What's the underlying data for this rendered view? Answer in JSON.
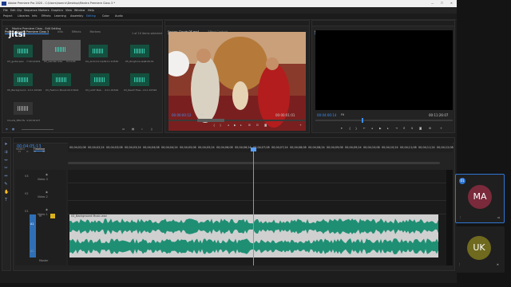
{
  "app": {
    "title": "Adobe Premiere Pro 2020 - C:\\Users\\hamric\\Desktop\\Mantra Premiere Class 3 *",
    "menu": [
      "File",
      "Edit",
      "Clip",
      "Sequence",
      "Markers",
      "Graphics",
      "View",
      "Window",
      "Help"
    ],
    "workspaces": [
      "Project",
      "Libraries",
      "Info",
      "Effects",
      "Learning",
      "Assembly",
      "Editing",
      "Color",
      "Audio"
    ],
    "window_controls": [
      "—",
      "☐",
      "✕"
    ]
  },
  "project_panel": {
    "tabs": [
      "Project: Mantra Premiere Class 3",
      "Info",
      "Effects",
      "Markers"
    ],
    "breadcrumb": "Mantra Premiere Class - Edit Setting",
    "item_count": "1 of 10 items selected",
    "logo": "jitsi",
    "clips": [
      {
        "name": "03_guitar.wav",
        "dur": "7:30:12224"
      },
      {
        "name": "03_Garden.wav",
        "dur": "0:14:03"
      },
      {
        "name": "04_Android.mp3",
        "dur": "4:11:10530"
      },
      {
        "name": "05_Ringtone.wav",
        "dur": "4:26:41"
      },
      {
        "name": "05_Background...",
        "dur": "0:11:01526"
      },
      {
        "name": "03_Fashion Mus...",
        "dur": "0:44:13204"
      },
      {
        "name": "03_LAST Ball...",
        "dur": "4:11:01526"
      },
      {
        "name": "03_Reel3 Files...",
        "dur": "4:11:01526"
      },
      {
        "name": "Clouds_PRO.flv",
        "dur": "4:00:01147"
      }
    ]
  },
  "source_monitor": {
    "tabs": [
      "Source: Clouds 08.mp4",
      "Effect Controls"
    ],
    "timecode_in": "00:00:00:12",
    "fit": "Fit",
    "timecode_out": "00:00:01:01"
  },
  "program_monitor": {
    "tabs": [
      "Program: Timeline"
    ],
    "timecode_in": "00:04:00:14",
    "fit": "Fit",
    "timecode_out": "00:11:26:07"
  },
  "timeline": {
    "tabs": [
      "VIDEO",
      "Timeline"
    ],
    "timecode": "00:04:05:13",
    "ruler": [
      "00;04;02;08",
      "00;04;02;24",
      "00;04;03;08",
      "00;04;03;24",
      "00;04;04;08",
      "00;04;04;24",
      "00;04;05;08",
      "00;04;05;24",
      "00;04;06;08",
      "00;04;06;24",
      "00;04;07;08",
      "00;04;07;24",
      "00;04;08;08",
      "00;04;08;24",
      "00;04;09;08",
      "00;04;09;24",
      "00;04;10;08",
      "00;04;10;24",
      "00;04;11;08",
      "00;04;11;24",
      "00;04;12;08"
    ],
    "tracks": [
      {
        "id": "V3",
        "name": "Video 3"
      },
      {
        "id": "V2",
        "name": "Video 2"
      },
      {
        "id": "V1",
        "name": "Video 1"
      },
      {
        "id": "A1",
        "name": "A"
      },
      {
        "id": "A2",
        "name": "A"
      }
    ],
    "master": "Master",
    "audio_clip_name": "03_Background Music.wav"
  },
  "participants": [
    {
      "initials": "MA",
      "badge": "01",
      "color": "#7a2a3b"
    },
    {
      "initials": "UK",
      "color": "#6f6a1e"
    }
  ],
  "colors": {
    "accent": "#3d8ef0",
    "waveform": "#1f8f74",
    "active_border": "#2f76d2"
  }
}
